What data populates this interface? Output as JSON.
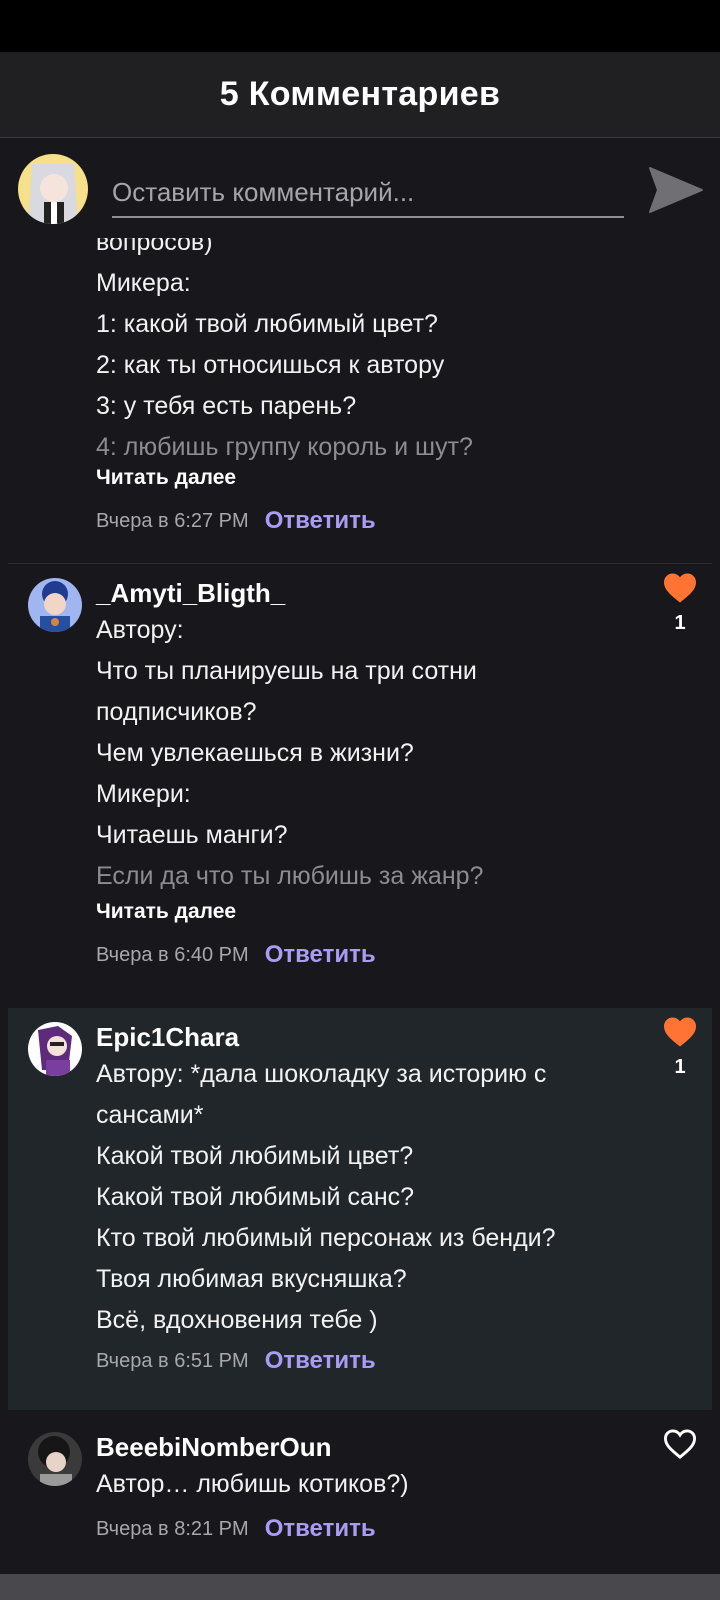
{
  "header": {
    "title": "5 Комментариев"
  },
  "composer": {
    "placeholder": "Оставить комментарий..."
  },
  "colors": {
    "accent": "#a99cf2",
    "like": "#ff7433",
    "background": "#18171c",
    "highlight": "#21262a"
  },
  "comments": [
    {
      "lines": [
        "вопросов)",
        "Микера:",
        "1: какой твой любимый цвет?",
        "2: как ты относишься к автору",
        "3: у тебя есть парень?",
        "4: любишь группу король и шут?"
      ],
      "read_more": "Читать далее",
      "timestamp": "Вчера в 6:27 PM",
      "reply": "Ответить"
    },
    {
      "username": "_Amyti_Bligth_",
      "lines": [
        "Автору:",
        "Что ты планируешь на три сотни",
        "подписчиков?",
        "Чем увлекаешься в жизни?",
        "Микери:",
        "Читаешь манги?",
        "Если да что ты любишь за жанр?"
      ],
      "read_more": "Читать далее",
      "timestamp": "Вчера в 6:40 PM",
      "reply": "Ответить",
      "likes": "1",
      "liked": true
    },
    {
      "username": "Epic1Chara",
      "lines": [
        "Автору: *дала шоколадку за историю с",
        "сансами*",
        "Какой твой любимый цвет?",
        "Какой твой любимый санс?",
        "Кто твой любимый персонаж из бенди?",
        "Твоя любимая вкусняшка?",
        "Всё, вдохновения тебе )"
      ],
      "timestamp": "Вчера в 6:51 PM",
      "reply": "Ответить",
      "likes": "1",
      "liked": true,
      "highlighted": true
    },
    {
      "username": "BeeebiNomberOun",
      "lines": [
        "Автор… любишь котиков?)"
      ],
      "timestamp": "Вчера в 8:21 PM",
      "reply": "Ответить",
      "liked": false
    }
  ]
}
